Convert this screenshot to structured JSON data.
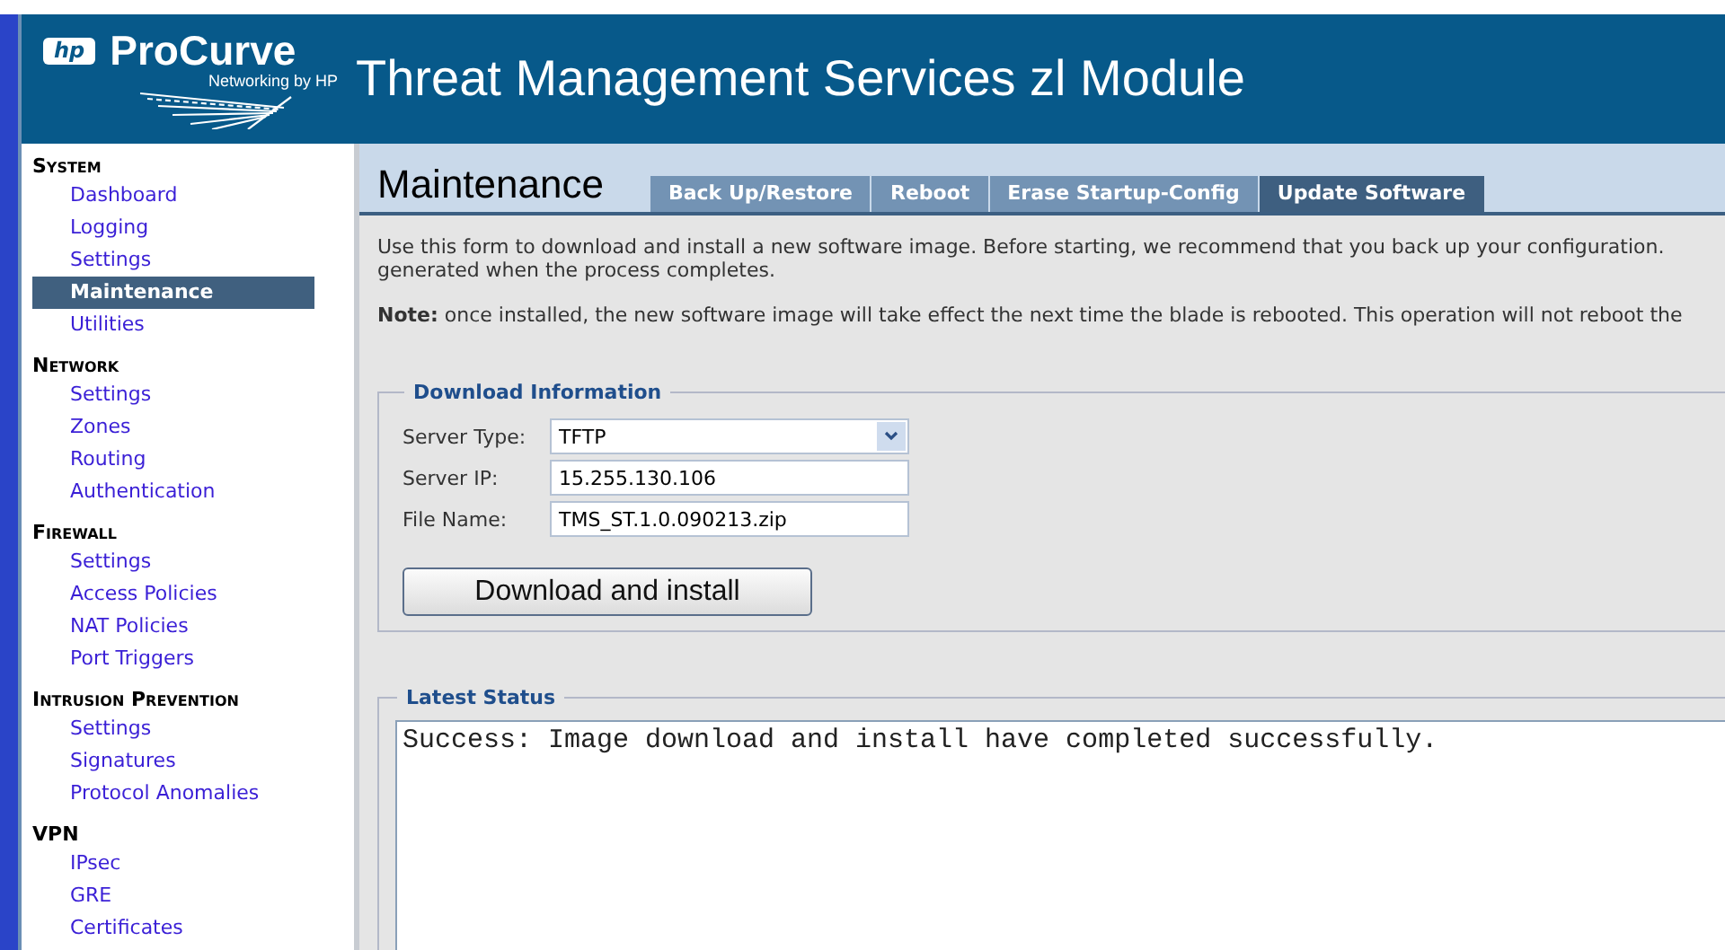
{
  "header": {
    "logo_badge": "hp",
    "brand": "ProCurve",
    "tagline": "Networking by HP",
    "title": "Threat Management Services zl Module"
  },
  "sidebar": {
    "sections": [
      {
        "heading": "System",
        "items": [
          {
            "label": "Dashboard",
            "selected": false
          },
          {
            "label": "Logging",
            "selected": false
          },
          {
            "label": "Settings",
            "selected": false
          },
          {
            "label": "Maintenance",
            "selected": true
          },
          {
            "label": "Utilities",
            "selected": false
          }
        ]
      },
      {
        "heading": "Network",
        "items": [
          {
            "label": "Settings",
            "selected": false
          },
          {
            "label": "Zones",
            "selected": false
          },
          {
            "label": "Routing",
            "selected": false
          },
          {
            "label": "Authentication",
            "selected": false
          }
        ]
      },
      {
        "heading": "Firewall",
        "items": [
          {
            "label": "Settings",
            "selected": false
          },
          {
            "label": "Access Policies",
            "selected": false
          },
          {
            "label": "NAT Policies",
            "selected": false
          },
          {
            "label": "Port Triggers",
            "selected": false
          }
        ]
      },
      {
        "heading": "Intrusion Prevention",
        "items": [
          {
            "label": "Settings",
            "selected": false
          },
          {
            "label": "Signatures",
            "selected": false
          },
          {
            "label": "Protocol Anomalies",
            "selected": false
          }
        ]
      },
      {
        "heading": "VPN",
        "items": [
          {
            "label": "IPsec",
            "selected": false
          },
          {
            "label": "GRE",
            "selected": false
          },
          {
            "label": "Certificates",
            "selected": false
          }
        ]
      }
    ]
  },
  "page": {
    "title": "Maintenance",
    "tabs": [
      {
        "label": "Back Up/Restore",
        "selected": false
      },
      {
        "label": "Reboot",
        "selected": false
      },
      {
        "label": "Erase Startup-Config",
        "selected": false
      },
      {
        "label": "Update Software",
        "selected": true
      }
    ],
    "description_lines": [
      "Use this form to download and install a new software image. Before starting, we recommend that you back up your configuration.",
      "generated when the process completes."
    ],
    "note": "**Note:** once installed, the new software image will take effect the next time the blade is rebooted. This operation will not reboot the",
    "download_information": {
      "legend": "Download Information",
      "fields": [
        {
          "kind": "select",
          "label": "Server Type:",
          "value": "TFTP"
        },
        {
          "kind": "text",
          "label": "Server IP:",
          "value": "15.255.130.106"
        },
        {
          "kind": "text",
          "label": "File Name:",
          "value": "TMS_ST.1.0.090213.zip"
        }
      ],
      "button": "Download and install"
    },
    "latest_status": {
      "legend": "Latest Status",
      "text": "Success: Image download and install have completed successfully."
    }
  }
}
